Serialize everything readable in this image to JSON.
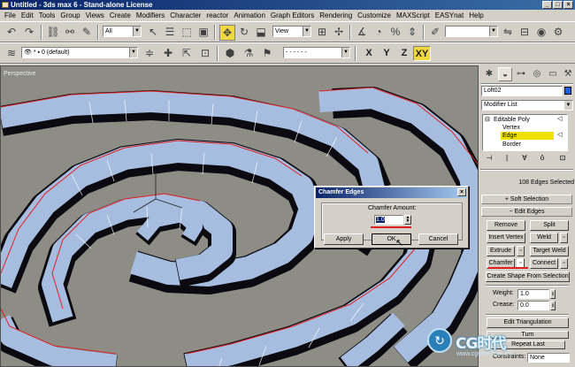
{
  "window": {
    "title": "Untitled - 3ds max 6 - Stand-alone License"
  },
  "menu": [
    "File",
    "Edit",
    "Tools",
    "Group",
    "Views",
    "Create",
    "Modifiers",
    "Character",
    "reactor",
    "Animation",
    "Graph Editors",
    "Rendering",
    "Customize",
    "MAXScript",
    "EASYnat",
    "Help"
  ],
  "toolbar": {
    "selection_filter": "All",
    "reference_coord": "View",
    "layer": "0 (default)",
    "axis_x": "X",
    "axis_y": "Y",
    "axis_z": "Z",
    "axis_xy": "XY"
  },
  "viewport": {
    "label": "Perspective"
  },
  "command_panel": {
    "object_name": "Loft02",
    "object_color": "#1a5fe0",
    "modifier_list": "Modifier List",
    "stack": [
      "Editable Poly",
      "Vertex",
      "Edge",
      "Border"
    ],
    "selected_subobject": "Edge",
    "selection_info": "108 Edges Selected",
    "soft_selection_label": "Soft Selection",
    "edit_edges_label": "Edit Edges",
    "buttons": {
      "remove": "Remove",
      "split": "Split",
      "insert_vertex": "Insert Vertex",
      "weld": "Weld",
      "extrude": "Extrude",
      "target_weld": "Target Weld",
      "chamfer": "Chamfer",
      "connect": "Connect",
      "create_shape": "Create Shape From Selection",
      "edit_triangulation": "Edit Triangulation",
      "turn": "Turn",
      "repeat_last": "Repeat Last"
    },
    "weight_label": "Weight:",
    "weight_value": "1.0",
    "crease_label": "Crease:",
    "crease_value": "0.0",
    "constraints_label": "Constraints:",
    "constraints_value": "None"
  },
  "dialog": {
    "title": "Chamfer Edges",
    "amount_label": "Chamfer Amount:",
    "amount_value": "1.0",
    "apply": "Apply",
    "ok": "OK",
    "cancel": "Cancel"
  },
  "watermark": {
    "brand": "CG时代",
    "url": "www.cgtime.com.cn"
  },
  "colors": {
    "accent": "#0a246a",
    "highlight": "#f0e000",
    "mesh": "#a7bde0",
    "selected_edge": "#e02020"
  }
}
